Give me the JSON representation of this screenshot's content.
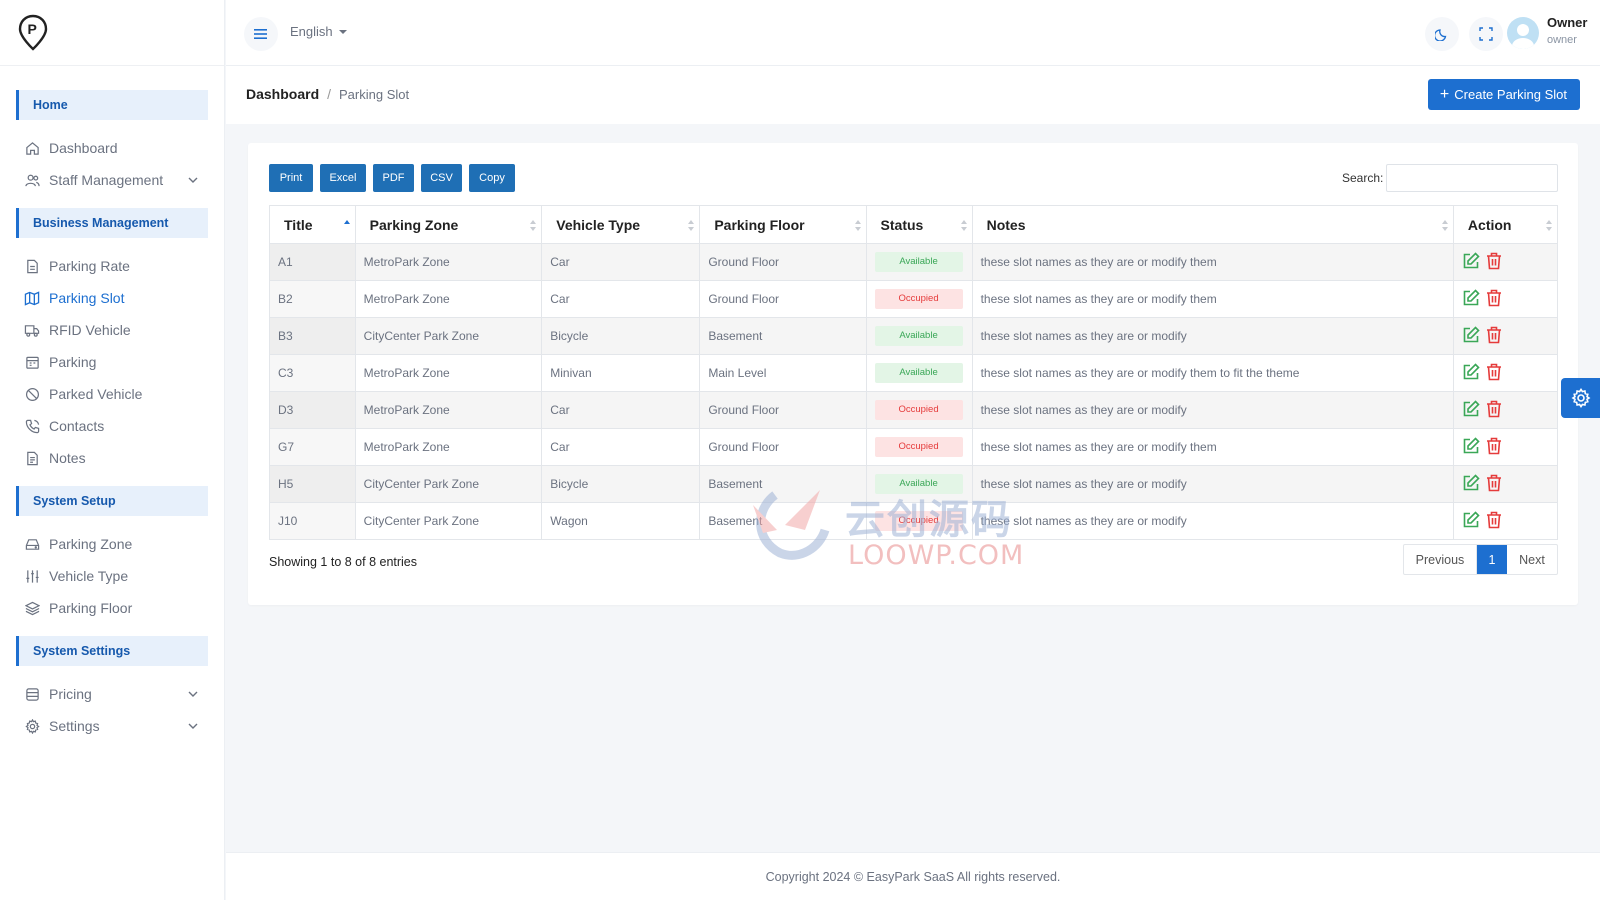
{
  "sidebar": {
    "sections": [
      {
        "title": "Home",
        "items": [
          {
            "label": "Dashboard",
            "icon": "home-icon"
          },
          {
            "label": "Staff Management",
            "icon": "users-icon",
            "expandable": true
          }
        ]
      },
      {
        "title": "Business Management",
        "items": [
          {
            "label": "Parking Rate",
            "icon": "document-icon"
          },
          {
            "label": "Parking Slot",
            "icon": "map-icon",
            "active": true
          },
          {
            "label": "RFID Vehicle",
            "icon": "truck-icon"
          },
          {
            "label": "Parking",
            "icon": "calendar-icon"
          },
          {
            "label": "Parked Vehicle",
            "icon": "ban-icon"
          },
          {
            "label": "Contacts",
            "icon": "phone-icon"
          },
          {
            "label": "Notes",
            "icon": "note-icon"
          }
        ]
      },
      {
        "title": "System Setup",
        "items": [
          {
            "label": "Parking Zone",
            "icon": "drive-icon"
          },
          {
            "label": "Vehicle Type",
            "icon": "sliders-icon"
          },
          {
            "label": "Parking Floor",
            "icon": "layers-icon"
          }
        ]
      },
      {
        "title": "System Settings",
        "items": [
          {
            "label": "Pricing",
            "icon": "database-icon",
            "expandable": true
          },
          {
            "label": "Settings",
            "icon": "gear-icon",
            "expandable": true
          }
        ]
      }
    ]
  },
  "topbar": {
    "language": "English",
    "user_name": "Owner",
    "user_role": "owner"
  },
  "breadcrumb": {
    "root": "Dashboard",
    "separator": "/",
    "current": "Parking Slot"
  },
  "create_button": "Create Parking Slot",
  "export_buttons": [
    "Print",
    "Excel",
    "PDF",
    "CSV",
    "Copy"
  ],
  "search_label": "Search:",
  "table": {
    "columns": [
      "Title",
      "Parking Zone",
      "Vehicle Type",
      "Parking Floor",
      "Status",
      "Notes",
      "Action"
    ],
    "rows": [
      {
        "title": "A1",
        "zone": "MetroPark Zone",
        "vehicle": "Car",
        "floor": "Ground Floor",
        "status": "Available",
        "notes": "these slot names as they are or modify them"
      },
      {
        "title": "B2",
        "zone": "MetroPark Zone",
        "vehicle": "Car",
        "floor": "Ground Floor",
        "status": "Occupied",
        "notes": "these slot names as they are or modify them"
      },
      {
        "title": "B3",
        "zone": "CityCenter Park Zone",
        "vehicle": "Bicycle",
        "floor": "Basement",
        "status": "Available",
        "notes": "these slot names as they are or modify"
      },
      {
        "title": "C3",
        "zone": "MetroPark Zone",
        "vehicle": "Minivan",
        "floor": "Main Level",
        "status": "Available",
        "notes": "these slot names as they are or modify them to fit the theme"
      },
      {
        "title": "D3",
        "zone": "MetroPark Zone",
        "vehicle": "Car",
        "floor": "Ground Floor",
        "status": "Occupied",
        "notes": "these slot names as they are or modify"
      },
      {
        "title": "G7",
        "zone": "MetroPark Zone",
        "vehicle": "Car",
        "floor": "Ground Floor",
        "status": "Occupied",
        "notes": "these slot names as they are or modify them"
      },
      {
        "title": "H5",
        "zone": "CityCenter Park Zone",
        "vehicle": "Bicycle",
        "floor": "Basement",
        "status": "Available",
        "notes": "these slot names as they are or modify"
      },
      {
        "title": "J10",
        "zone": "CityCenter Park Zone",
        "vehicle": "Wagon",
        "floor": "Basement",
        "status": "Occupied",
        "notes": "these slot names as they are or modify"
      }
    ]
  },
  "table_info": "Showing 1 to 8 of 8 entries",
  "pagination": {
    "previous": "Previous",
    "current": "1",
    "next": "Next"
  },
  "footer": "Copyright 2024 © EasyPark SaaS All rights reserved.",
  "watermark": {
    "cn": "云创源码",
    "en": "LOOWP.COM"
  },
  "colors": {
    "accent": "#1d6fd0",
    "available": "#3aa757",
    "occupied": "#e53b3b",
    "edit": "#3aa757",
    "delete": "#e53b3b"
  }
}
